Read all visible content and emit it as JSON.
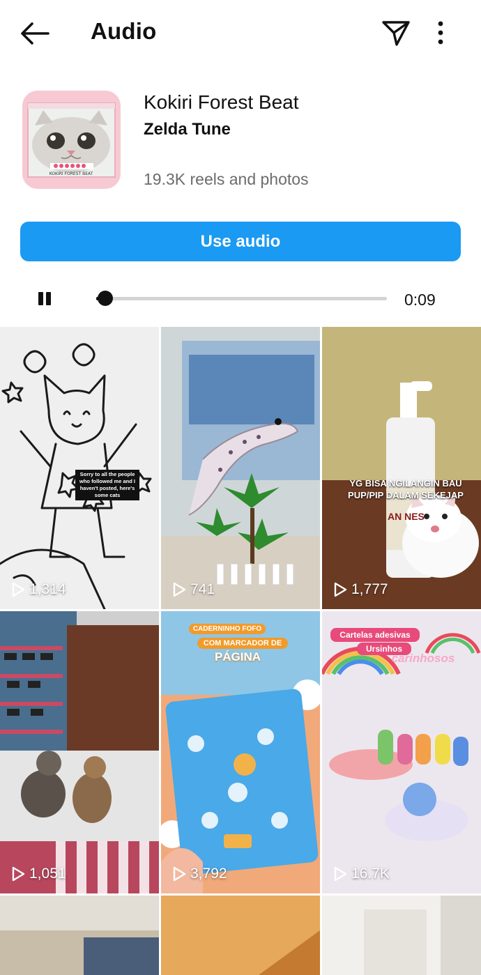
{
  "header": {
    "title": "Audio",
    "back_icon": "arrow-left-icon",
    "share_icon": "send-icon",
    "more_icon": "more-vertical-icon"
  },
  "audio": {
    "track_name": "Kokiri Forest Beat",
    "artist": "Zelda Tune",
    "count": "19.3K reels and photos",
    "cover_caption": "KOKIRI FOREST BEAT",
    "use_button": "Use audio",
    "time": "0:09",
    "progress": 0.01
  },
  "colors": {
    "accent": "#1a9af2",
    "cover_bg": "#f7c9d3"
  },
  "reels": [
    {
      "views": "1,314",
      "caption": "Sorry to all the people who followed me and I haven't posted, here's some cats"
    },
    {
      "views": "741"
    },
    {
      "views": "1,777",
      "caption": "YG BISA NGILANGIN BAU PUP/PIP DALAM SEKEJAP",
      "product": "AN NES"
    },
    {
      "views": "1,051"
    },
    {
      "views": "3,792",
      "caption_top": "CADERNINHO FOFO",
      "caption_mid": "COM MARCADOR DE",
      "caption_big": "PÁGINA"
    },
    {
      "views": "16.7K",
      "caption_top": "Cartelas adesivas",
      "caption_mid": "Ursinhos",
      "caption_script": "carinhosos"
    }
  ]
}
